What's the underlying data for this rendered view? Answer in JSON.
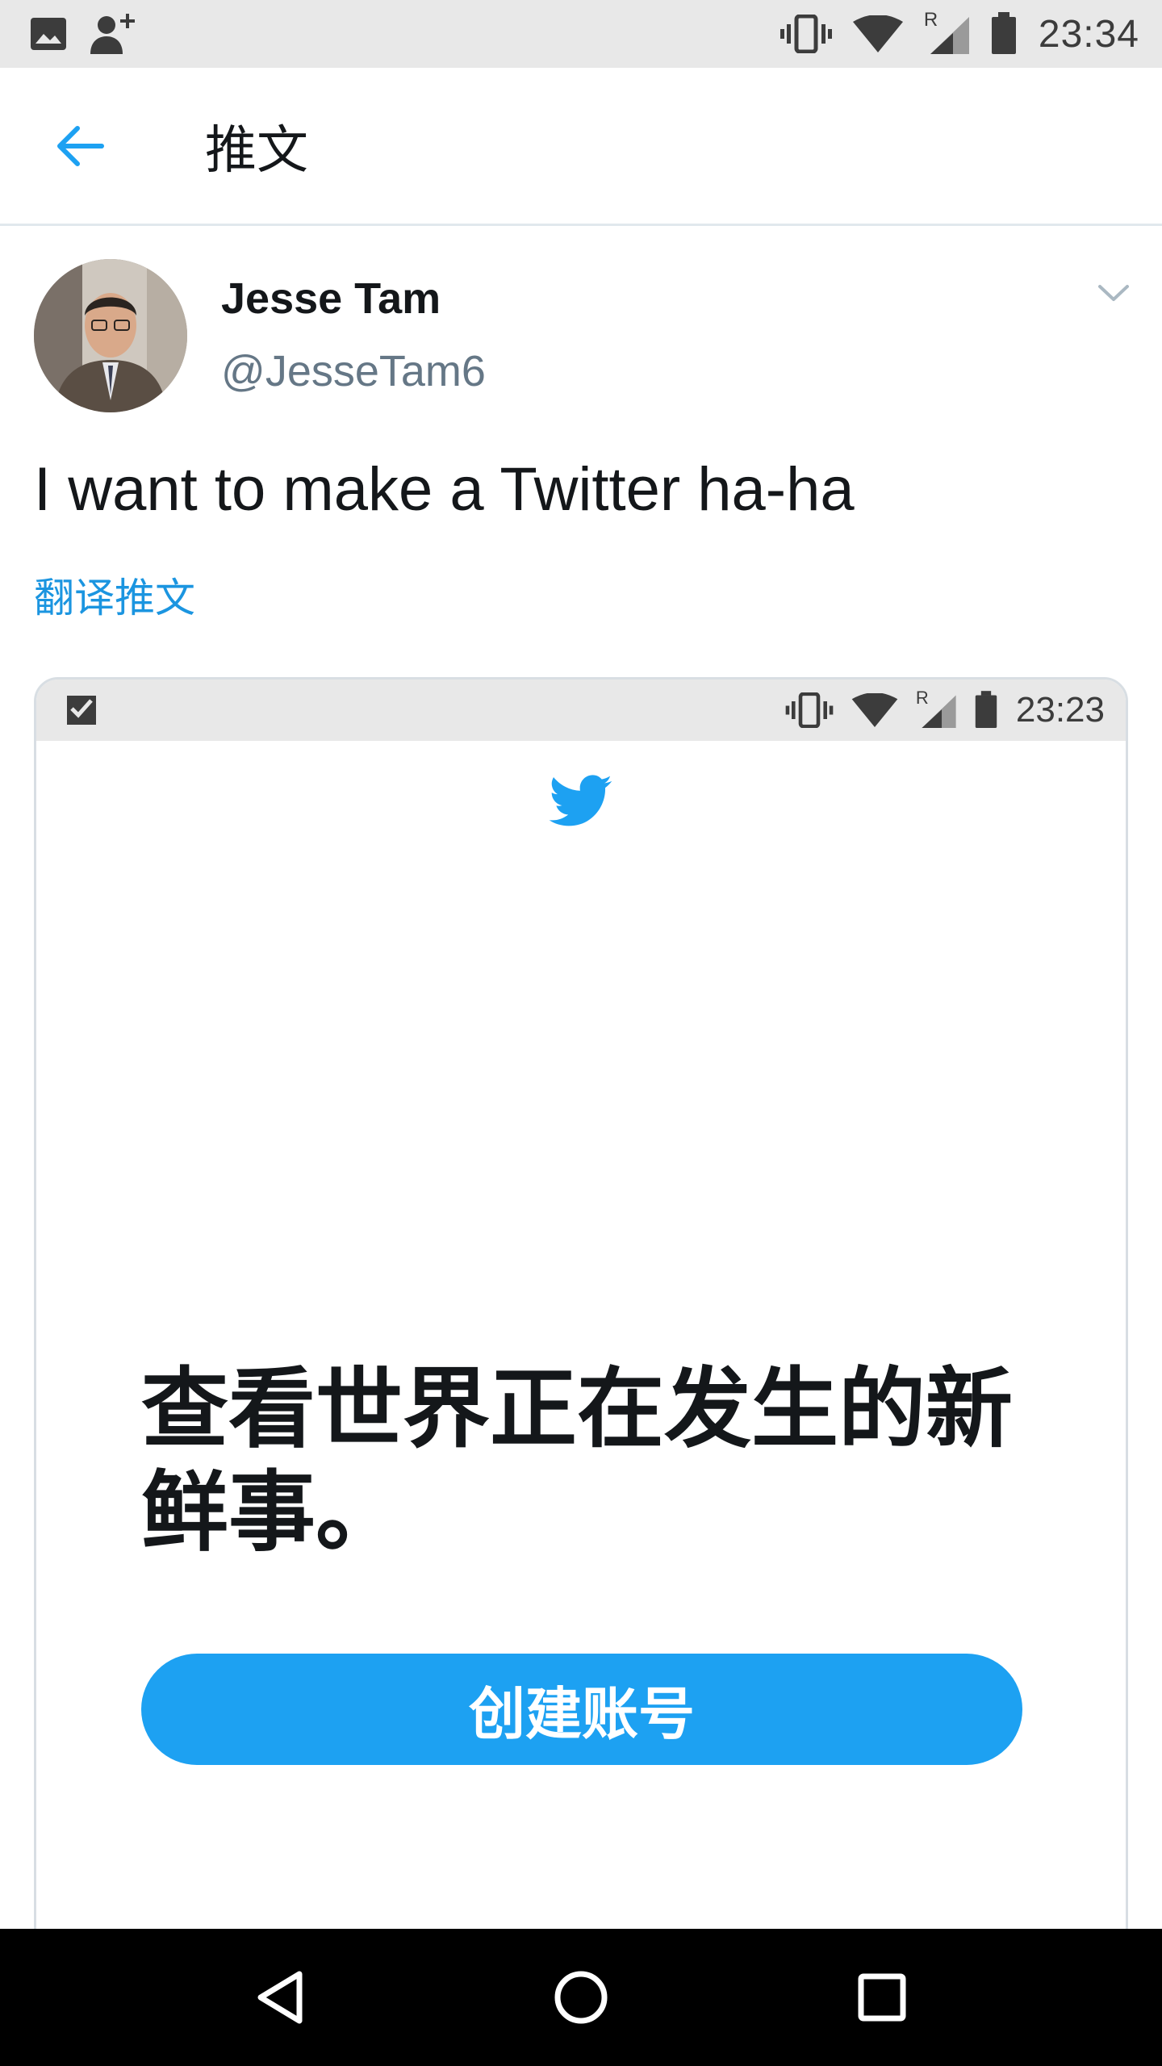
{
  "status_bar": {
    "time": "23:34",
    "left_icons": [
      "gallery-icon",
      "add-contact-icon"
    ],
    "right_icons": [
      "vibrate-icon",
      "wifi-icon",
      "signal-roaming-icon",
      "battery-icon"
    ],
    "roaming_label": "R"
  },
  "app_bar": {
    "back_icon": "arrow-left-icon",
    "title": "推文",
    "accent_color": "#1da1f2"
  },
  "tweet": {
    "author_name": "Jesse Tam",
    "author_handle": "@JesseTam6",
    "text": "I want to make a Twitter ha-ha",
    "translate_label": "翻译推文",
    "menu_icon": "chevron-down-icon"
  },
  "embedded_screenshot": {
    "status_time": "23:23",
    "roaming_label": "R",
    "headline": "查看世界正在发生的新鲜事。",
    "button_label": "创建账号",
    "logo_icon": "twitter-bird-icon",
    "button_color": "#1da1f2"
  },
  "nav_bar": {
    "icons": [
      "back-triangle-icon",
      "home-circle-icon",
      "recents-square-icon"
    ]
  }
}
